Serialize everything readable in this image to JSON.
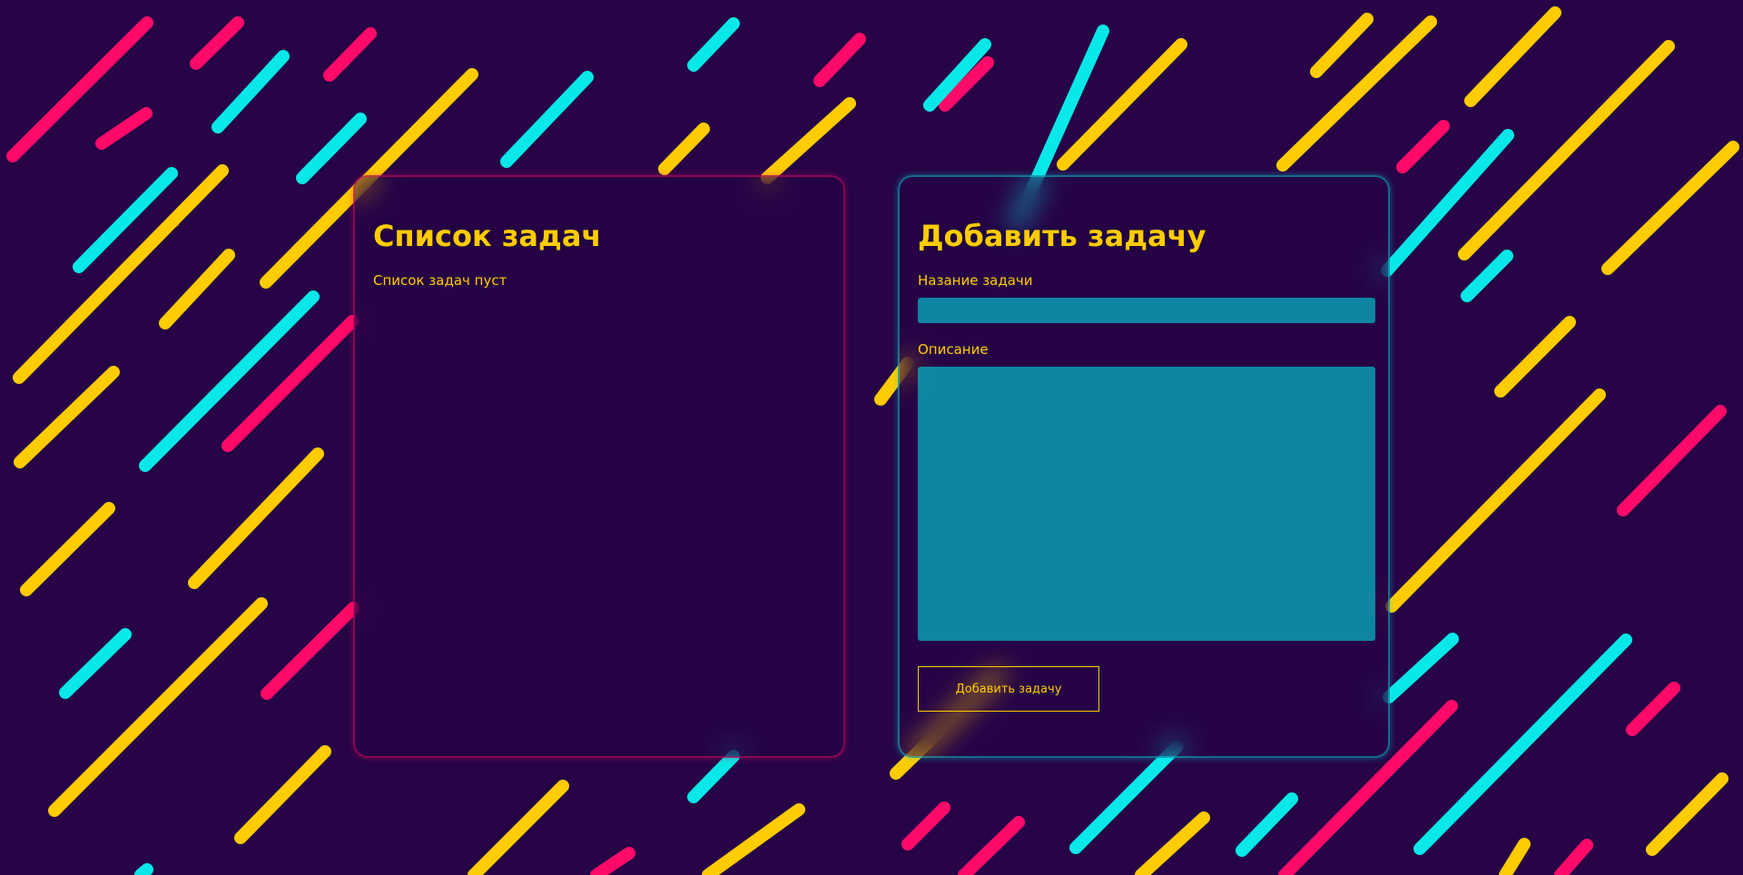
{
  "theme": {
    "background": "#260446",
    "accent_text": "#ffcc00",
    "line_colors": [
      "#ff0a68",
      "#ffcc00",
      "#08e8e8"
    ],
    "input_fill": "#0a9fb4",
    "left_border": "#ff0866",
    "right_border": "#06e6e6"
  },
  "task_list": {
    "title": "Список задач",
    "empty_message": "Список задач пуст"
  },
  "add_task": {
    "title": "Добавить задачу",
    "name_label": "Назание задачи",
    "name_value": "",
    "description_label": "Описание",
    "description_value": "",
    "submit_label": "Добавить задачу"
  },
  "decor": {
    "cursor_icon": "cursor-arrow-icon"
  }
}
